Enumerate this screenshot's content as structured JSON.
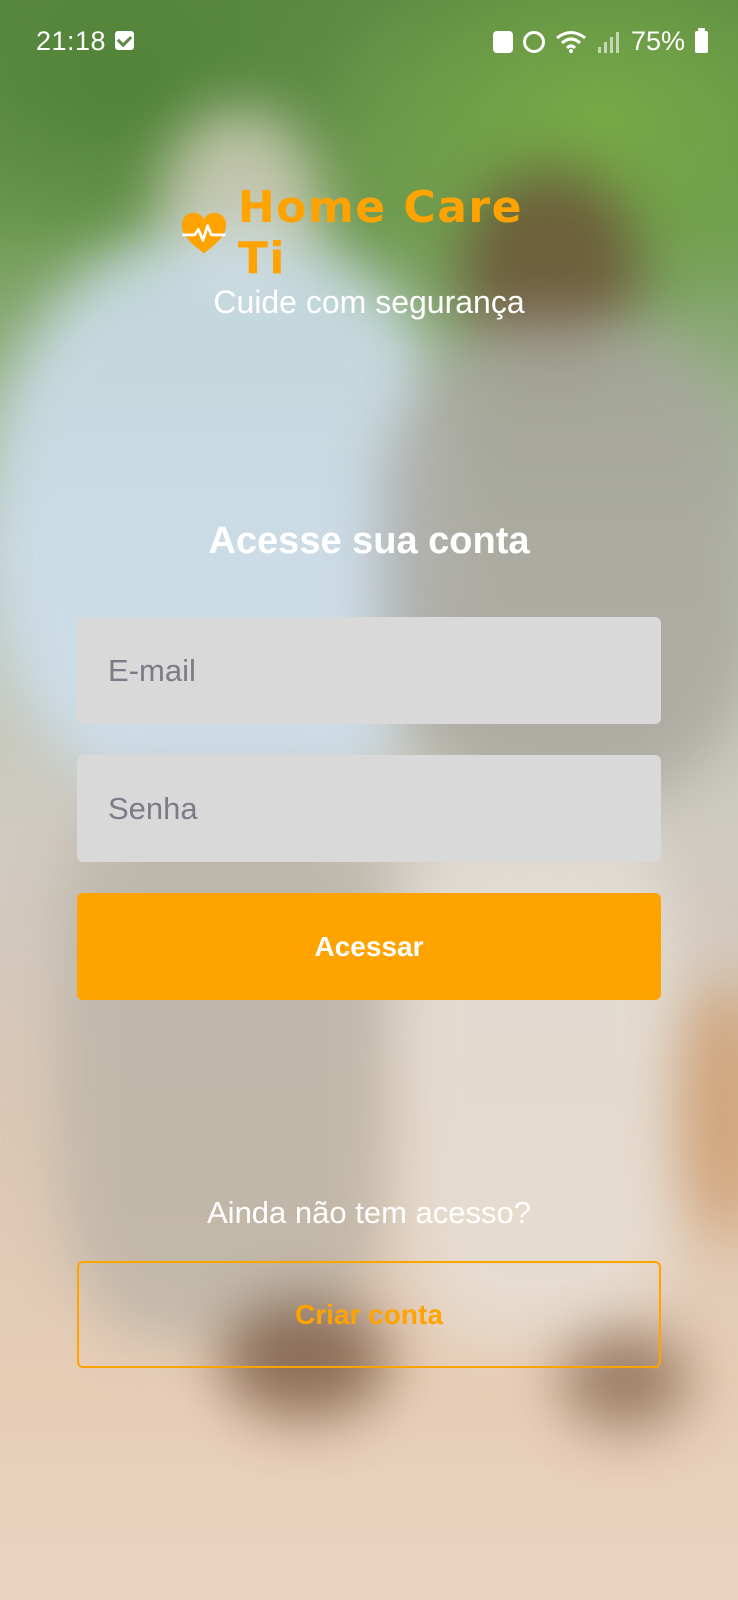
{
  "status_bar": {
    "time": "21:18",
    "battery": "75%",
    "icons": [
      "check-notification-icon",
      "recycle-icon",
      "alarm-icon",
      "wifi-icon",
      "signal-icon",
      "battery-icon"
    ]
  },
  "brand": {
    "name": "Home Care Ti",
    "tagline": "Cuide com segurança",
    "logo_icon": "heart-pulse-icon",
    "accent_color": "#ffa300"
  },
  "login": {
    "title": "Acesse sua conta",
    "email_placeholder": "E-mail",
    "password_placeholder": "Senha",
    "submit_label": "Acessar"
  },
  "signup": {
    "prompt": "Ainda não tem acesso?",
    "button_label": "Criar conta"
  }
}
